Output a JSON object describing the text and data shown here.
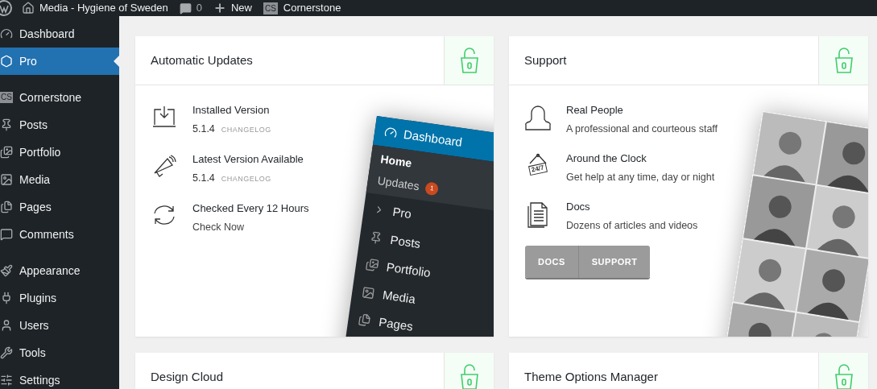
{
  "admin_bar": {
    "site_name": "Media - Hygiene of Sweden",
    "comments_count": "0",
    "new_label": "New",
    "cornerstone_badge": "CS",
    "cornerstone_label": "Cornerstone"
  },
  "sidebar": {
    "groups": [
      [
        {
          "label": "Dashboard",
          "selected": false
        },
        {
          "label": "Pro",
          "selected": true
        }
      ],
      [
        {
          "label": "Cornerstone",
          "selected": false,
          "badge": "CS"
        },
        {
          "label": "Posts",
          "selected": false
        },
        {
          "label": "Portfolio",
          "selected": false
        },
        {
          "label": "Media",
          "selected": false
        },
        {
          "label": "Pages",
          "selected": false
        },
        {
          "label": "Comments",
          "selected": false
        }
      ],
      [
        {
          "label": "Appearance",
          "selected": false
        },
        {
          "label": "Plugins",
          "selected": false
        },
        {
          "label": "Users",
          "selected": false
        },
        {
          "label": "Tools",
          "selected": false
        },
        {
          "label": "Settings",
          "selected": false
        }
      ]
    ]
  },
  "cards": [
    {
      "kind": "updates",
      "title": "Automatic Updates",
      "items": [
        {
          "title": "Installed Version",
          "version": "5.1.4",
          "link": "CHANGELOG"
        },
        {
          "title": "Latest Version Available",
          "version": "5.1.4",
          "link": "CHANGELOG"
        },
        {
          "title": "Checked Every 12 Hours",
          "action": "Check Now"
        }
      ],
      "preview": {
        "header": "Dashboard",
        "submenu": [
          {
            "label": "Home"
          },
          {
            "label": "Updates",
            "badge": "1"
          }
        ],
        "menu": [
          "Pro",
          "Posts",
          "Portfolio",
          "Media",
          "Pages"
        ]
      }
    },
    {
      "kind": "support",
      "title": "Support",
      "items": [
        {
          "title": "Real People",
          "subtitle": "A professional and courteous staff"
        },
        {
          "title": "Around the Clock",
          "subtitle": "Get help at any time, day or night",
          "sign": "24/7"
        },
        {
          "title": "Docs",
          "subtitle": "Dozens of articles and videos"
        }
      ],
      "buttons": [
        "DOCS",
        "SUPPORT"
      ]
    },
    {
      "kind": "plain",
      "title": "Design Cloud"
    },
    {
      "kind": "plain",
      "title": "Theme Options Manager"
    }
  ]
}
